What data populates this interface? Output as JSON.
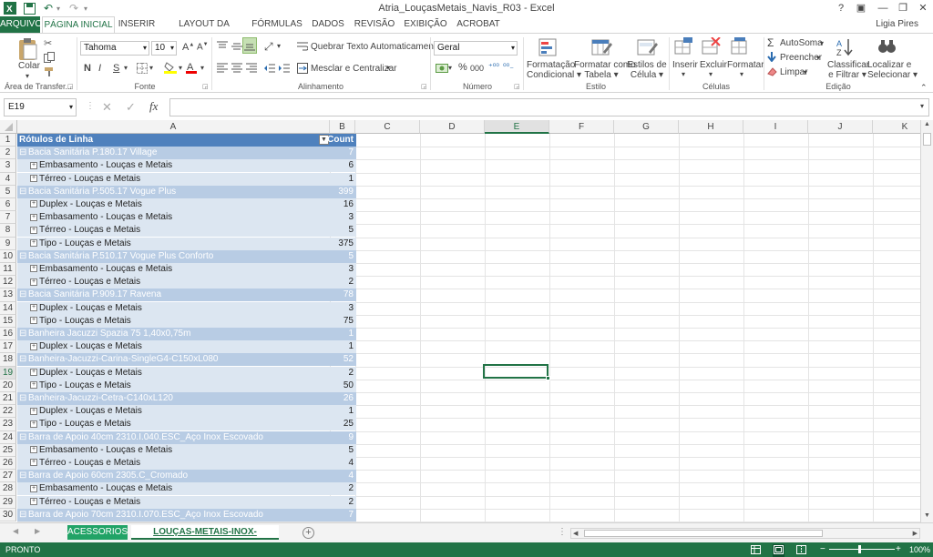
{
  "window": {
    "title": "Atria_LouçasMetais_Navis_R03 - Excel",
    "user": "Ligia Pires",
    "help": "?",
    "min": "—",
    "restore": "❐",
    "close": "✕",
    "ribbon_opts": "▣"
  },
  "tabs": [
    "ARQUIVO",
    "PÁGINA INICIAL",
    "INSERIR",
    "LAYOUT DA PÁGINA",
    "FÓRMULAS",
    "DADOS",
    "REVISÃO",
    "EXIBIÇÃO",
    "ACROBAT"
  ],
  "ribbon": {
    "clipboard": {
      "paste": "Colar",
      "label": "Área de Transfer..."
    },
    "font": {
      "name": "Tahoma",
      "size": "10",
      "bold": "N",
      "italic": "I",
      "underline": "S",
      "label": "Fonte"
    },
    "alignment": {
      "wrap": "Quebrar Texto Automaticamente",
      "merge": "Mesclar e Centralizar",
      "label": "Alinhamento"
    },
    "number": {
      "format": "Geral",
      "percent": "%",
      "thousands": "000",
      "label": "Número"
    },
    "styles": {
      "conditional": [
        "Formatação",
        "Condicional"
      ],
      "table": [
        "Formatar como",
        "Tabela"
      ],
      "cell": [
        "Estilos de",
        "Célula"
      ],
      "label": "Estilo"
    },
    "cells": {
      "insert": "Inserir",
      "delete": "Excluir",
      "format": "Formatar",
      "label": "Células"
    },
    "editing": {
      "autosum": "AutoSoma",
      "fill": "Preencher",
      "clear": "Limpar",
      "sort": [
        "Classificar",
        "e Filtrar"
      ],
      "find": [
        "Localizar e",
        "Selecionar"
      ],
      "label": "Edição"
    }
  },
  "formula_bar": {
    "name_box": "E19",
    "fx": "fx",
    "value": ""
  },
  "columns": [
    "A",
    "B",
    "C",
    "D",
    "E",
    "F",
    "G",
    "H",
    "I",
    "J",
    "K"
  ],
  "selected_column": "E",
  "selected_row": 19,
  "pivot": {
    "header": {
      "label": "Rótulos de Linha",
      "value": "Count"
    },
    "rows": [
      {
        "row": 2,
        "level": 1,
        "label": "Bacia Sanitária P.180.17 Village",
        "value": "7"
      },
      {
        "row": 3,
        "level": 2,
        "label": "Embasamento - Louças e Metais",
        "value": "6"
      },
      {
        "row": 4,
        "level": 2,
        "label": "Térreo - Louças e Metais",
        "value": "1"
      },
      {
        "row": 5,
        "level": 1,
        "label": "Bacia Sanitária P.505.17 Vogue Plus",
        "value": "399"
      },
      {
        "row": 6,
        "level": 2,
        "label": "Duplex - Louças e Metais",
        "value": "16"
      },
      {
        "row": 7,
        "level": 2,
        "label": "Embasamento - Louças e Metais",
        "value": "3"
      },
      {
        "row": 8,
        "level": 2,
        "label": "Térreo - Louças e Metais",
        "value": "5"
      },
      {
        "row": 9,
        "level": 2,
        "label": "Tipo - Louças e Metais",
        "value": "375"
      },
      {
        "row": 10,
        "level": 1,
        "label": "Bacia Sanitária P.510.17 Vogue Plus Conforto",
        "value": "5"
      },
      {
        "row": 11,
        "level": 2,
        "label": "Embasamento - Louças e Metais",
        "value": "3"
      },
      {
        "row": 12,
        "level": 2,
        "label": "Térreo - Louças e Metais",
        "value": "2"
      },
      {
        "row": 13,
        "level": 1,
        "label": "Bacia Sanitária P.909.17 Ravena",
        "value": "78"
      },
      {
        "row": 14,
        "level": 2,
        "label": "Duplex - Louças e Metais",
        "value": "3"
      },
      {
        "row": 15,
        "level": 2,
        "label": "Tipo - Louças e Metais",
        "value": "75"
      },
      {
        "row": 16,
        "level": 1,
        "label": "Banheira Jacuzzi Spazia 75 1,40x0,75m",
        "value": "1"
      },
      {
        "row": 17,
        "level": 2,
        "label": "Duplex - Louças e Metais",
        "value": "1"
      },
      {
        "row": 18,
        "level": 1,
        "label": "Banheira-Jacuzzi-Carina-SingleG4-C150xL080",
        "value": "52"
      },
      {
        "row": 19,
        "level": 2,
        "label": "Duplex - Louças e Metais",
        "value": "2"
      },
      {
        "row": 20,
        "level": 2,
        "label": "Tipo - Louças e Metais",
        "value": "50"
      },
      {
        "row": 21,
        "level": 1,
        "label": "Banheira-Jacuzzi-Cetra-C140xL120",
        "value": "26"
      },
      {
        "row": 22,
        "level": 2,
        "label": "Duplex - Louças e Metais",
        "value": "1"
      },
      {
        "row": 23,
        "level": 2,
        "label": "Tipo - Louças e Metais",
        "value": "25"
      },
      {
        "row": 24,
        "level": 1,
        "label": "Barra de Apoio 40cm 2310.I.040.ESC_Aço Inox Escovado",
        "value": "9"
      },
      {
        "row": 25,
        "level": 2,
        "label": "Embasamento - Louças e Metais",
        "value": "5"
      },
      {
        "row": 26,
        "level": 2,
        "label": "Térreo - Louças e Metais",
        "value": "4"
      },
      {
        "row": 27,
        "level": 1,
        "label": "Barra de Apoio 60cm 2305.C_Cromado",
        "value": "4"
      },
      {
        "row": 28,
        "level": 2,
        "label": "Embasamento - Louças e Metais",
        "value": "2"
      },
      {
        "row": 29,
        "level": 2,
        "label": "Térreo - Louças e Metais",
        "value": "2"
      },
      {
        "row": 30,
        "level": 1,
        "label": "Barra de Apoio 70cm 2310.I.070.ESC_Aço Inox Escovado",
        "value": "7"
      }
    ]
  },
  "sheets": {
    "inactive": "ACESSORIOS",
    "active": "LOUÇAS-METAIS-INOX-BANHEIRA",
    "add": "+"
  },
  "status": {
    "ready": "PRONTO",
    "zoom": "100%"
  },
  "colors": {
    "accent": "#217346",
    "pivot_header": "#4f81bd",
    "pivot_level1": "#b8cce4",
    "pivot_level2": "#dce6f1"
  }
}
